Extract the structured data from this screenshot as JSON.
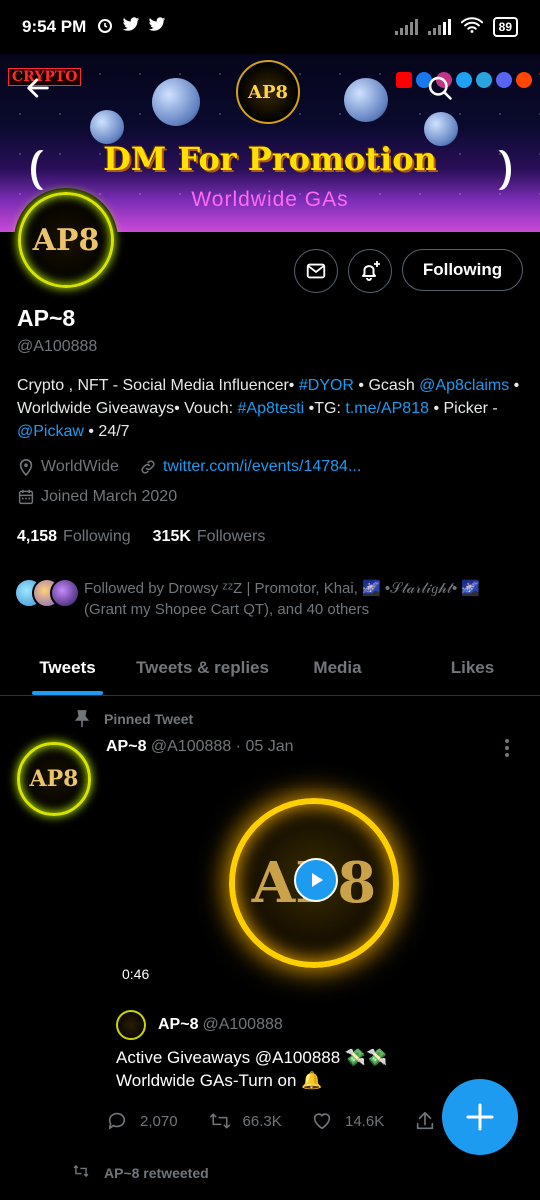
{
  "status_bar": {
    "time": "9:54 PM",
    "battery": "89"
  },
  "banner": {
    "crypto_tag": "CRYPTO",
    "logo_text": "AP8",
    "promo_title": "DM For Promotion",
    "promo_subtitle": "Worldwide GAs"
  },
  "profile": {
    "avatar_text": "AP8",
    "name": "AP~8",
    "handle": "@A100888",
    "following_button": "Following",
    "bio": {
      "p1": "Crypto , NFT - Social Media Influencer• ",
      "tag1": "#DYOR",
      "p2": " • Gcash ",
      "mention1": "@Ap8claims",
      "p3": " • Worldwide Giveaways• Vouch: ",
      "tag2": "#Ap8testi",
      "p4": " •TG: ",
      "link1": "t.me/AP818",
      "p5": " • Picker - ",
      "mention2": "@Pickaw",
      "p6": " • 24/7"
    },
    "location": "WorldWide",
    "website": "twitter.com/i/events/14784...",
    "joined": "Joined March 2020",
    "following_count": "4,158",
    "following_label": "Following",
    "followers_count": "315K",
    "followers_label": "Followers",
    "followed_by": "Followed by Drowsy ᶻᶻZ | Promotor, Khai, 🌌 •𝒮𝓉𝒶𝓇𝓁𝒾𝑔𝒽𝓉• 🌌 (Grant my Shopee Cart QT), and 40 others"
  },
  "tabs": [
    {
      "label": "Tweets"
    },
    {
      "label": "Tweets & replies"
    },
    {
      "label": "Media"
    },
    {
      "label": "Likes"
    }
  ],
  "tweet": {
    "pinned_label": "Pinned Tweet",
    "avatar_text": "AP8",
    "author": "AP~8",
    "handle_date": "@A100888 · 05 Jan",
    "media_text": "AP8",
    "duration": "0:46",
    "quote": {
      "author": "AP~8",
      "handle": "@A100888",
      "line1": "Active Giveaways  @A100888 💸💸",
      "line2": "Worldwide GAs-Turn on 🔔"
    },
    "replies": "2,070",
    "retweets": "66.3K",
    "likes": "14.6K"
  },
  "next_item": {
    "retweeted_label": "AP~8 retweeted"
  },
  "colors": {
    "accent": "#1d9bf0",
    "muted": "#71767b",
    "background": "#000000"
  },
  "icons": [
    "alarm-icon",
    "twitter-icon",
    "signal-icon",
    "wifi-icon",
    "battery-icon",
    "back-arrow-icon",
    "search-icon",
    "mail-icon",
    "bell-plus-icon",
    "location-icon",
    "link-icon",
    "calendar-icon",
    "pin-icon",
    "more-vertical-icon",
    "play-icon",
    "reply-icon",
    "retweet-icon",
    "heart-icon",
    "share-icon",
    "compose-plus-icon"
  ]
}
